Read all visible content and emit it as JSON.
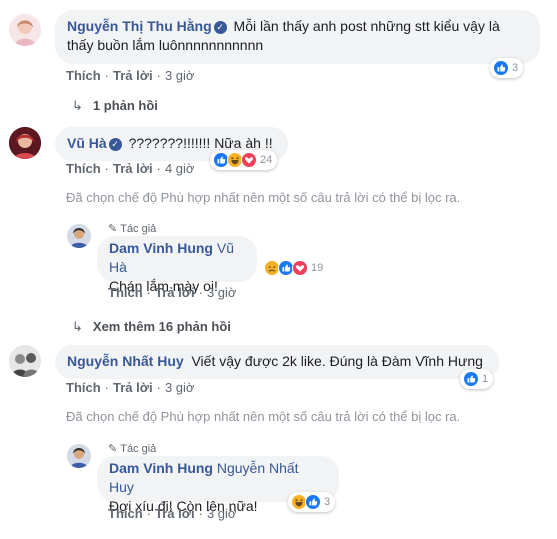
{
  "actions": {
    "like": "Thích",
    "reply": "Trả lời",
    "sep": "·"
  },
  "filter_note": "Đã chọn chế độ Phù hợp nhất nên một số câu trả lời có thể bị lọc ra.",
  "author_badge": "Tác giả",
  "comments": [
    {
      "author": "Nguyễn Thị Thu Hằng",
      "verified": true,
      "text_line1": "Mỗi lần thấy anh post những stt kiểu vậy là",
      "text_line2": "thấy buồn lắm luônnnnnnnnnnn",
      "time": "3 giờ",
      "reaction_count": "3",
      "reactions": [
        "like"
      ],
      "replies_link": "1 phản hồi"
    },
    {
      "author": "Vũ Hà",
      "verified": true,
      "text": "???????!!!!!!! Nữa àh !!",
      "time": "4 giờ",
      "reaction_count": "24",
      "reactions": [
        "like",
        "haha",
        "love"
      ],
      "reply": {
        "author": "Dam Vinh Hung",
        "tag": "Vũ Hà",
        "text": "Chán lắm mày oi!",
        "time": "3 giờ",
        "reaction_count": "19",
        "reactions": [
          "sad",
          "like",
          "love"
        ]
      },
      "more_replies": "Xem thêm 16 phản hồi"
    },
    {
      "author": "Nguyễn Nhất Huy",
      "verified": false,
      "text": "Viết vậy được 2k like. Đúng là Đàm Vĩnh Hưng",
      "time": "3 giờ",
      "reaction_count": "1",
      "reactions": [
        "like"
      ],
      "reply": {
        "author": "Dam Vinh Hung",
        "tag": "Nguyễn Nhất Huy",
        "text": "Đợi xíu đi! Còn lên nữa!",
        "time": "3 giờ",
        "reaction_count": "3",
        "reactions": [
          "haha",
          "like"
        ]
      }
    }
  ],
  "colors": {
    "name": "#385898",
    "bubble": "#f2f3f5",
    "meta": "#606770",
    "like": "#1877f2",
    "love": "#f33e58",
    "haha": "#f7b125"
  }
}
